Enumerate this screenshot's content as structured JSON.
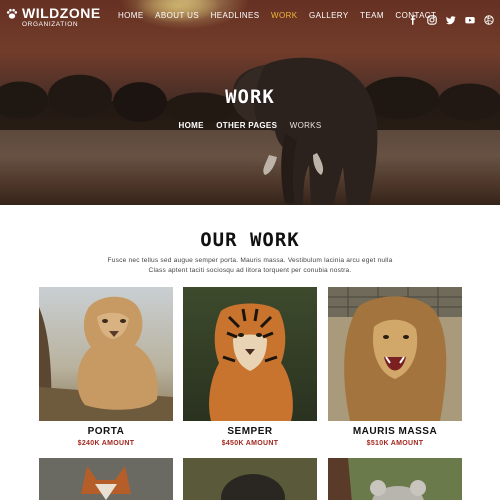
{
  "brand": {
    "name": "WILDZONE",
    "sub": "ORGANIZATION"
  },
  "nav": {
    "items": [
      {
        "label": "HOME",
        "active": false
      },
      {
        "label": "ABOUT US",
        "active": false
      },
      {
        "label": "HEADLINES",
        "active": false
      },
      {
        "label": "WORK",
        "active": true
      },
      {
        "label": "GALLERY",
        "active": false
      },
      {
        "label": "TEAM",
        "active": false
      },
      {
        "label": "CONTACT",
        "active": false
      }
    ],
    "social": [
      "facebook-icon",
      "instagram-icon",
      "twitter-icon",
      "youtube-icon",
      "globe-icon"
    ]
  },
  "hero": {
    "title": "WORK",
    "breadcrumb": {
      "home": "HOME",
      "other": "OTHER PAGES",
      "current": "WORKS"
    }
  },
  "section": {
    "title": "OUR WORK",
    "description": "Fusce nec tellus sed augue semper porta. Mauris massa. Vestibulum lacinia arcu eget nulla Class aptent taciti sociosqu ad litora torquent per conubia nostra."
  },
  "cards": [
    {
      "name": "PORTA",
      "amount": "$240K AMOUNT"
    },
    {
      "name": "SEMPER",
      "amount": "$450K AMOUNT"
    },
    {
      "name": "MAURIS MASSA",
      "amount": "$510K AMOUNT"
    }
  ],
  "colors": {
    "accent": "#f2b53d",
    "amount": "#a3281f"
  }
}
